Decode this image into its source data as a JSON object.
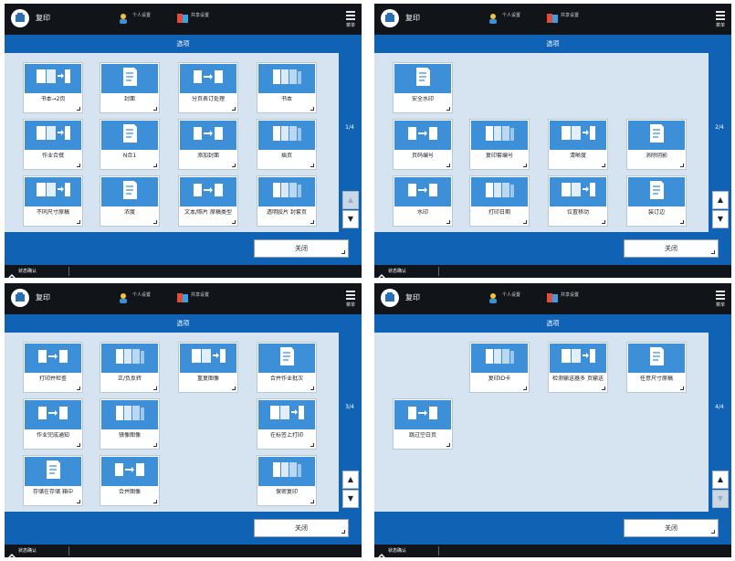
{
  "header": {
    "copy_label": "复印",
    "personal_settings": "个人设置",
    "shared_settings": "共享设置",
    "menu_label": "菜单"
  },
  "title": "选项",
  "close_label": "关闭",
  "status_label": "状态确认",
  "colors": {
    "topbar": "#111418",
    "accent": "#0f62b4",
    "tile_icon": "#3d8fd8",
    "content_bg": "#d6e3f0"
  },
  "panels": [
    {
      "page": "1/4",
      "up_enabled": false,
      "down_enabled": true,
      "tiles": [
        {
          "label": "书本→2页",
          "icon": "book-to-pages-icon"
        },
        {
          "label": "封面",
          "icon": "cover-icon"
        },
        {
          "label": "分页表订处理",
          "icon": "booklet-icon"
        },
        {
          "label": "书本",
          "icon": "book-icon"
        },
        {
          "label": "作业合撰",
          "icon": "job-build-icon"
        },
        {
          "label": "N合1",
          "icon": "n-on-1-icon"
        },
        {
          "label": "添加封面",
          "icon": "add-cover-icon"
        },
        {
          "label": "插页",
          "icon": "insert-sheets-icon"
        },
        {
          "label": "不同尺寸原稿",
          "icon": "different-size-originals-icon"
        },
        {
          "label": "浓度",
          "icon": "density-icon"
        },
        {
          "label": "文本/照片 原稿类型",
          "icon": "original-type-icon"
        },
        {
          "label": "透明胶片 封套页",
          "icon": "transparency-interleaf-icon"
        }
      ]
    },
    {
      "page": "2/4",
      "up_enabled": true,
      "down_enabled": true,
      "tiles": [
        {
          "label": "安全水印",
          "icon": "secure-watermark-icon"
        },
        {
          "label": "页码编号",
          "icon": "page-numbering-icon"
        },
        {
          "label": "复印套编号",
          "icon": "copy-set-numbering-icon"
        },
        {
          "label": "清晰度",
          "icon": "sharpness-icon"
        },
        {
          "label": "消除阴影",
          "icon": "erase-frame-icon"
        },
        {
          "label": "水印",
          "icon": "watermark-icon"
        },
        {
          "label": "打印日期",
          "icon": "print-date-icon"
        },
        {
          "label": "位置移动",
          "icon": "shift-icon"
        },
        {
          "label": "装订边",
          "icon": "gutter-icon"
        }
      ]
    },
    {
      "page": "3/4",
      "up_enabled": true,
      "down_enabled": true,
      "tiles": [
        {
          "label": "打印并检查",
          "icon": "sample-print-icon"
        },
        {
          "label": "正/负反转",
          "icon": "negative-positive-icon"
        },
        {
          "label": "重复图像",
          "icon": "image-repeat-icon"
        },
        {
          "label": "合并作业批次",
          "icon": "combine-batches-icon"
        },
        {
          "label": "作业完成通知",
          "icon": "job-done-notice-icon"
        },
        {
          "label": "镜像图像",
          "icon": "mirror-image-icon"
        },
        {
          "label": "在标签上打印",
          "icon": "print-on-tab-icon"
        },
        {
          "label": "存储在存储 箱中",
          "icon": "store-in-box-icon"
        },
        {
          "label": "合并图像",
          "icon": "merge-image-icon"
        },
        {
          "label": "保密复印",
          "icon": "secured-copy-icon"
        }
      ]
    },
    {
      "page": "4/4",
      "up_enabled": true,
      "down_enabled": false,
      "tiles": [
        {
          "label": "复印ID卡",
          "icon": "id-card-copy-icon"
        },
        {
          "label": "检测输送器多 页输送",
          "icon": "multi-feed-detect-icon"
        },
        {
          "label": "任意尺寸原稿",
          "icon": "free-size-originals-icon"
        },
        {
          "label": "跳过空白页",
          "icon": "skip-blank-pages-icon"
        }
      ]
    }
  ]
}
